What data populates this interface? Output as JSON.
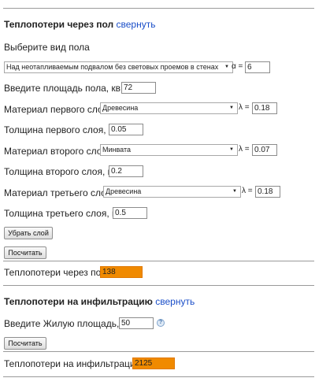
{
  "floor_section": {
    "title": "Теплопотери через пол",
    "toggle_link": "свернуть",
    "floor_type_prompt": "Выберите вид пола",
    "floor_type_selected": "Над неотапливаемым подвалом без световых проемов в стенах",
    "alpha_label": "α =",
    "alpha_value": "6",
    "area_label": "Введите площадь пола, кв.м.",
    "area_value": "72",
    "layers": [
      {
        "material_label": "Материал первого слоя",
        "material_selected": "Древесина",
        "lambda_label": "λ =",
        "lambda_value": "0.18",
        "thickness_label": "Толщина первого слоя, м.",
        "thickness_value": "0.05"
      },
      {
        "material_label": "Материал второго слоя",
        "material_selected": "Минвата",
        "lambda_label": "λ =",
        "lambda_value": "0.07",
        "thickness_label": "Толщина второго слоя, м.",
        "thickness_value": "0.2"
      },
      {
        "material_label": "Материал третьего слоя",
        "material_selected": "Древесина",
        "lambda_label": "λ =",
        "lambda_value": "0.18",
        "thickness_label": "Толщина третьего слоя, м.",
        "thickness_value": "0.5"
      }
    ],
    "remove_layer_button": "Убрать слой",
    "calculate_button": "Посчитать",
    "result_label": "Теплопотери через пол",
    "result_value": "138"
  },
  "infiltration_section": {
    "title": "Теплопотери на инфильтрацию",
    "toggle_link": "свернуть",
    "area_label": "Введите Жилую площадь, м.",
    "area_value": "50",
    "help_icon_glyph": "?",
    "calculate_button": "Посчитать",
    "result_label": "Теплопотери на инфильтрацию",
    "result_value": "2125"
  },
  "colors": {
    "link": "#1a4ec8",
    "result_background": "#f08a00",
    "rule": "#9a9a9a"
  },
  "icons": {
    "dropdown": "chevron-down-icon",
    "help": "help-icon"
  }
}
